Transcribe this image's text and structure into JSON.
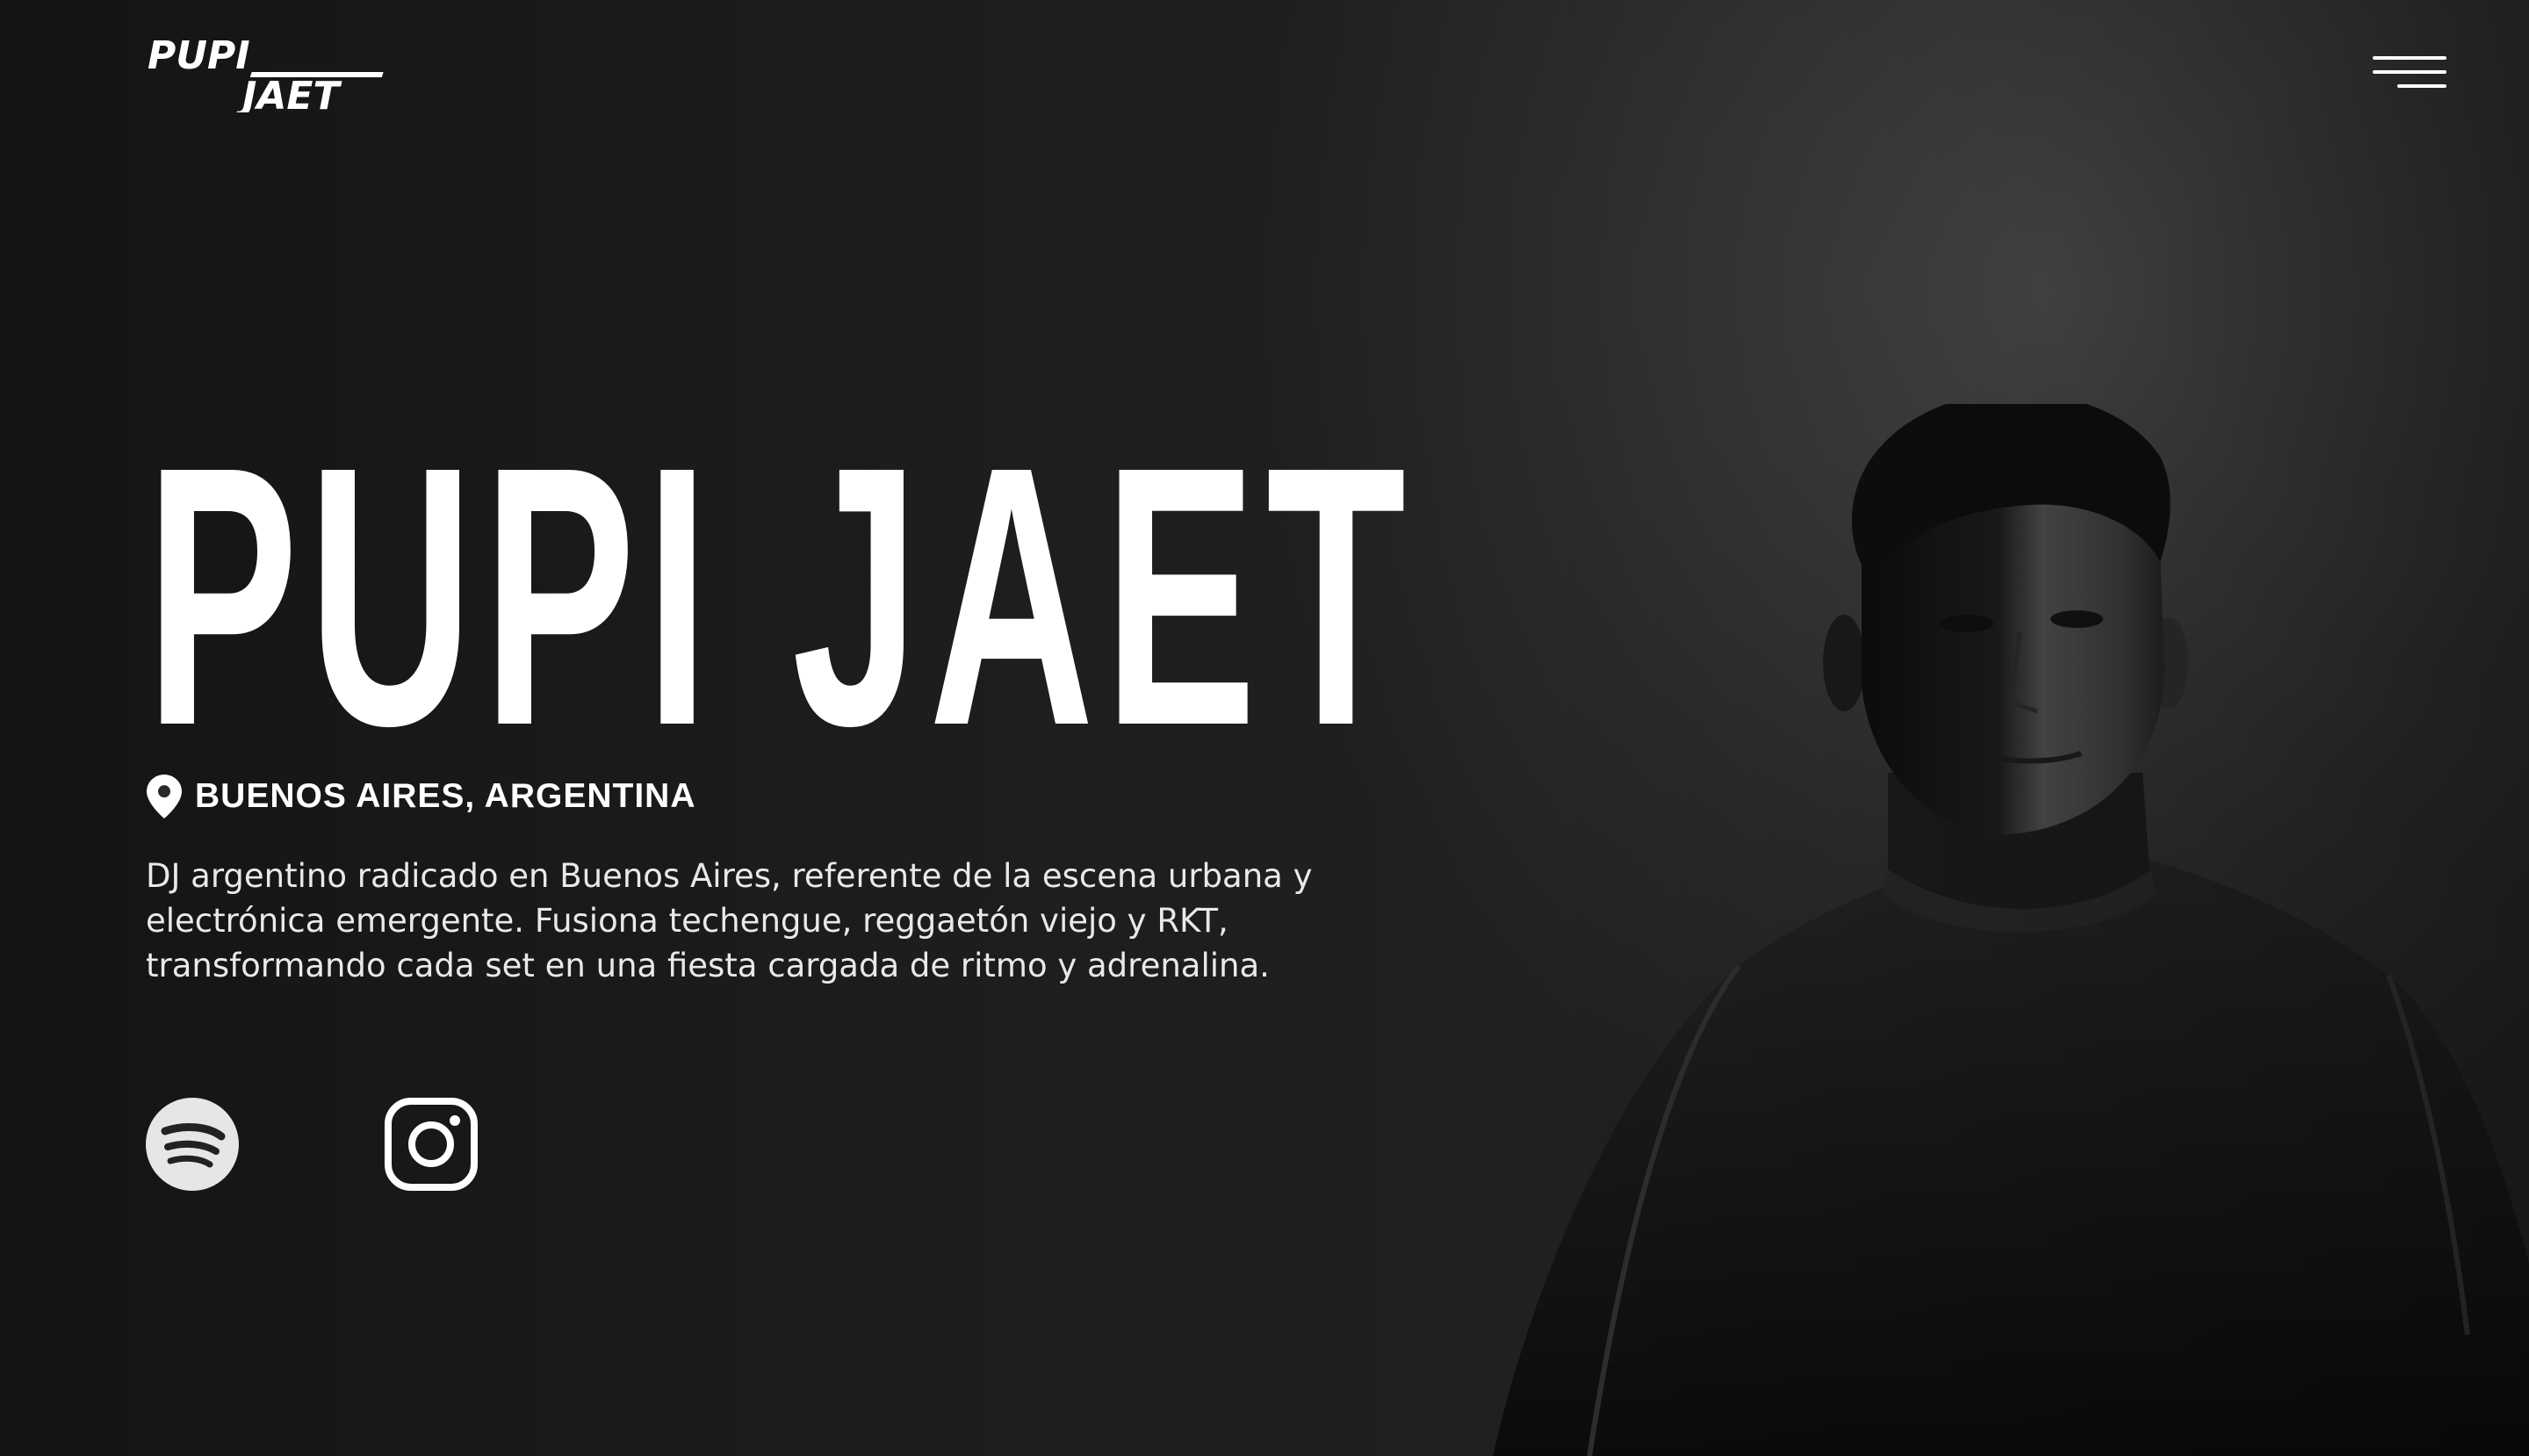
{
  "header": {
    "logo_text": "PUPI JAET",
    "menu_icon": "hamburger-menu-icon"
  },
  "hero": {
    "title": "PUPI JAET",
    "location_icon": "map-pin-icon",
    "location": "BUENOS AIRES, ARGENTINA",
    "bio": "DJ argentino radicado en Buenos Aires, referente de la escena urbana y electrónica emergente. Fusiona techengue, reggaetón viejo y RKT, transformando cada set en una fiesta cargada de ritmo y adrenalina."
  },
  "social": [
    {
      "name": "Spotify",
      "icon": "spotify-icon"
    },
    {
      "name": "Instagram",
      "icon": "instagram-icon"
    }
  ],
  "colors": {
    "background": "#222222",
    "text": "#ffffff",
    "muted_text": "#e9e9e9",
    "icon_light": "#e6e6e6"
  }
}
